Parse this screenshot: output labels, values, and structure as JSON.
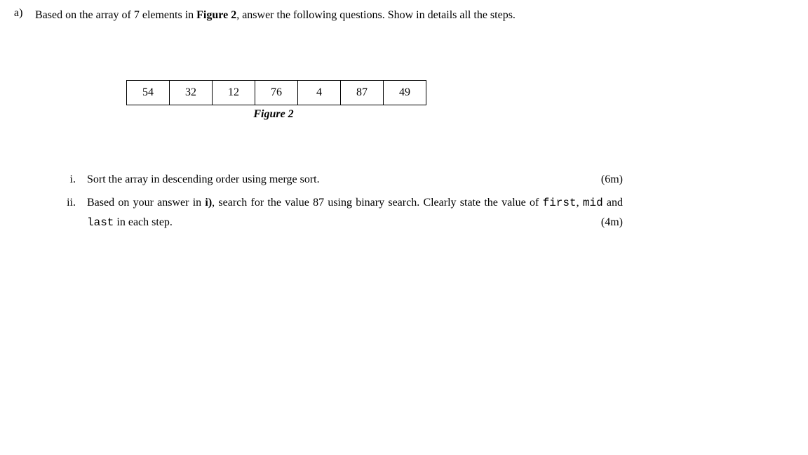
{
  "question_a": {
    "label": "a)",
    "text_part1": "Based on the array of 7 elements in ",
    "text_bold": "Figure 2",
    "text_part2": ", answer the following questions. Show in details all the steps."
  },
  "figure": {
    "cells": [
      "54",
      "32",
      "12",
      "76",
      "4",
      "87",
      "49"
    ],
    "caption": "Figure 2"
  },
  "sub_i": {
    "label": "i.",
    "text": "Sort the array in descending order using merge sort.",
    "marks": "(6m)"
  },
  "sub_ii": {
    "label": "ii.",
    "line1_part1": "Based on your answer in ",
    "line1_bold": "i)",
    "line1_part2": ", search for the value 87 using binary search. Clearly state the value of ",
    "mono1": "first",
    "sep1": ", ",
    "mono2": "mid",
    "sep2": " and ",
    "mono3": "last",
    "line1_part3": " in each step.",
    "marks": "(4m)"
  }
}
